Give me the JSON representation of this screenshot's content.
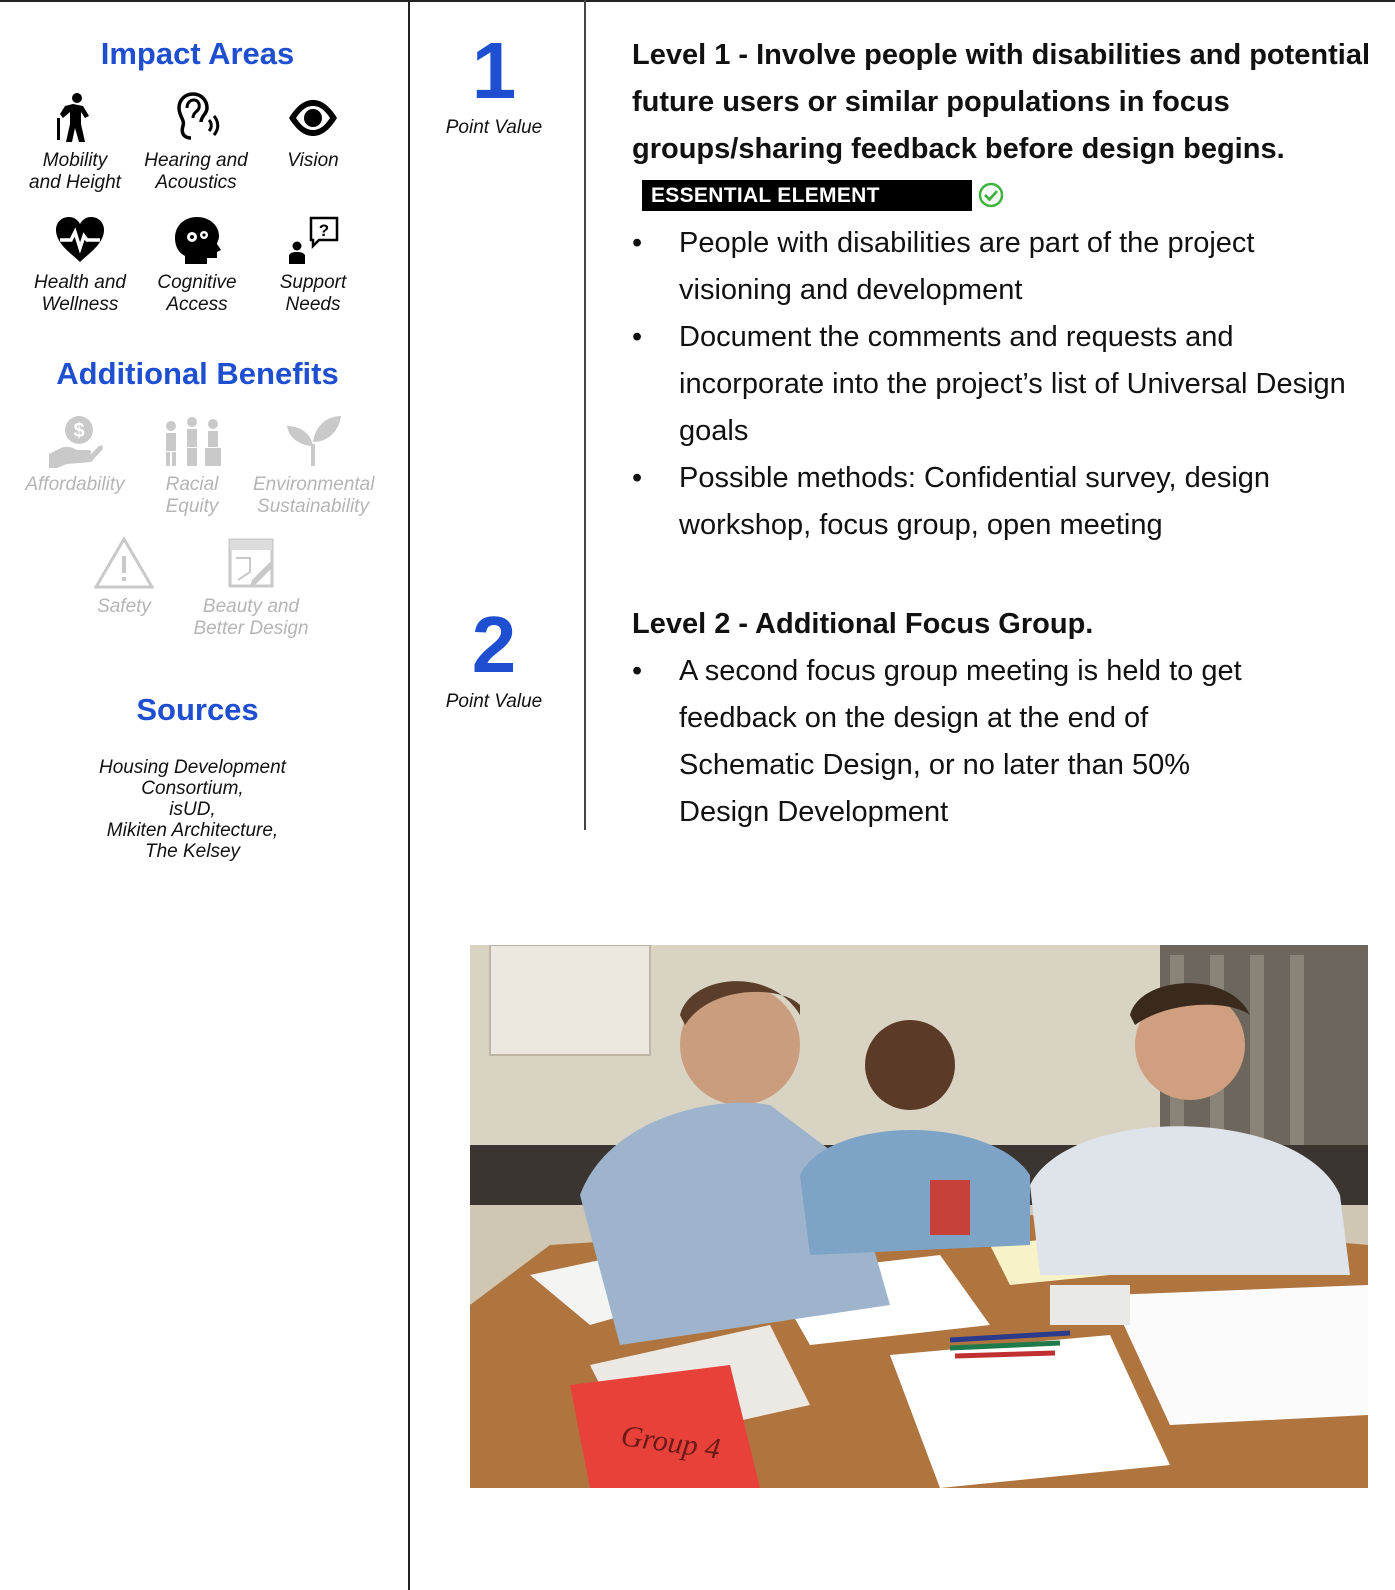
{
  "sidebar": {
    "impact_title": "Impact Areas",
    "impact_items": [
      {
        "icon": "mobility-icon",
        "line1": "Mobility",
        "line2": "and Height"
      },
      {
        "icon": "hearing-icon",
        "line1": "Hearing and",
        "line2": "Acoustics"
      },
      {
        "icon": "vision-icon",
        "line1": "Vision",
        "line2": ""
      },
      {
        "icon": "heart-icon",
        "line1": "Health and",
        "line2": "Wellness"
      },
      {
        "icon": "brain-icon",
        "line1": "Cognitive",
        "line2": "Access"
      },
      {
        "icon": "support-icon",
        "line1": "Support",
        "line2": "Needs"
      }
    ],
    "benefits_title": "Additional Benefits",
    "benefit_items": [
      {
        "icon": "affordability-icon",
        "line1": "Affordability",
        "line2": ""
      },
      {
        "icon": "racial-equity-icon",
        "line1": "Racial",
        "line2": "Equity"
      },
      {
        "icon": "sustainability-icon",
        "line1": "Environmental",
        "line2": "Sustainability"
      },
      {
        "icon": "safety-icon",
        "line1": "Safety",
        "line2": ""
      },
      {
        "icon": "design-icon",
        "line1": "Beauty and",
        "line2": "Better Design"
      }
    ],
    "sources_title": "Sources",
    "sources": [
      "Housing Development",
      "Consortium,",
      "isUD,",
      "Mikiten Architecture,",
      "The Kelsey"
    ]
  },
  "point_values": [
    {
      "number": "1",
      "label": "Point Value"
    },
    {
      "number": "2",
      "label": "Point Value"
    }
  ],
  "levels": [
    {
      "title": "Level 1 - Involve people with disabilities and potential future users or similar populations in focus groups/sharing feedback before design begins.",
      "badge": "ESSENTIAL ELEMENT",
      "bullets": [
        "People with disabilities are part of the project visioning and development",
        "Document the comments and requests and incorporate into the project’s list of Universal Design goals",
        "Possible methods: Confidential survey, design workshop, focus group, open meeting"
      ]
    },
    {
      "title": "Level 2 - Additional Focus Group.",
      "bullets": [
        "A second focus group meeting is held to get feedback on the design at the end of Schematic Design, or no later than 50% Design Development"
      ]
    }
  ],
  "photo": {
    "sign_text": "Group 4"
  },
  "colors": {
    "accent": "#1f4fd1",
    "check": "#3db33d",
    "dim": "#b5b5b5"
  }
}
